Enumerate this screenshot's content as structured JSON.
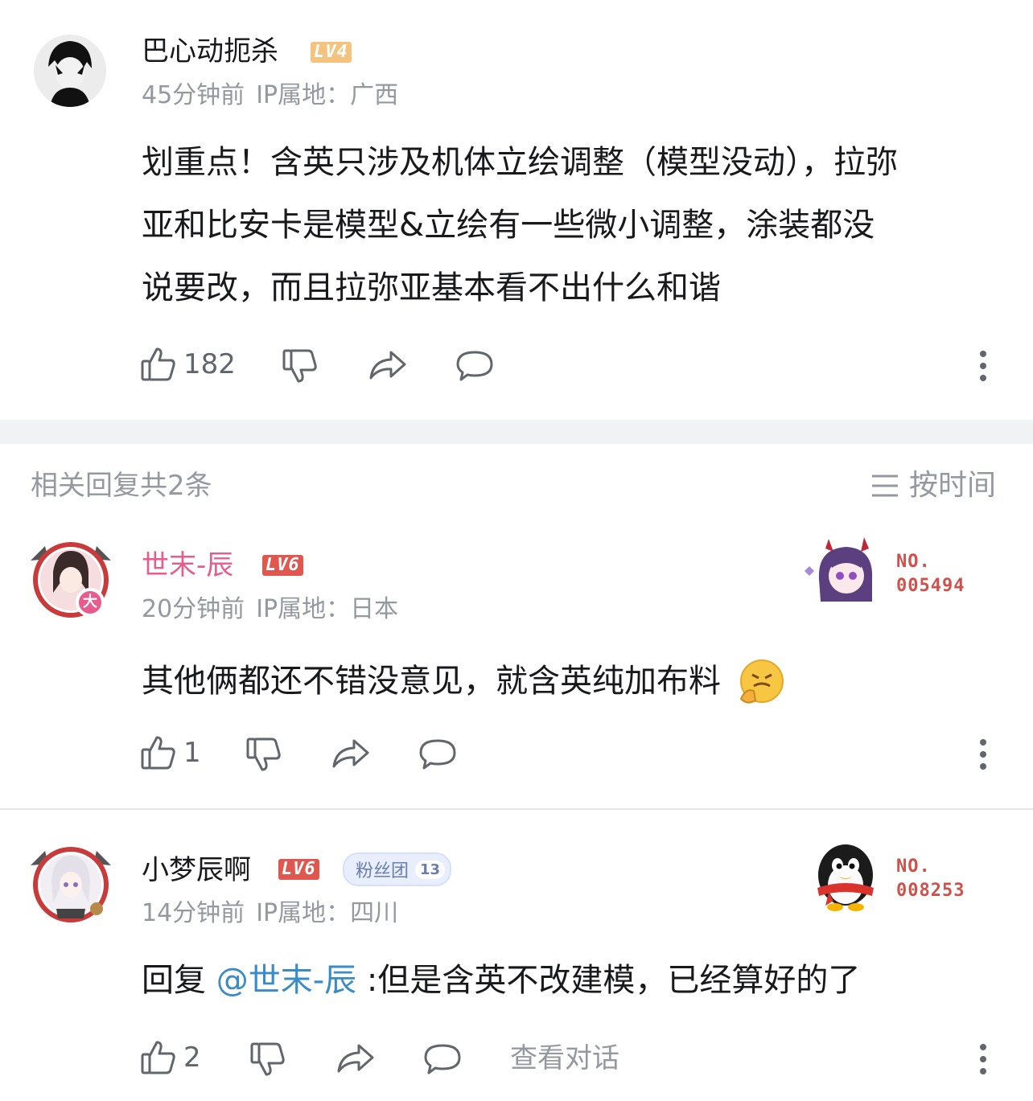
{
  "comment": {
    "user_name": "巴心动扼杀",
    "level": "LV4",
    "time": "45分钟前",
    "ip": "IP属地：广西",
    "text_lines": [
      "划重点！含英只涉及机体立绘调整（模型没动），拉弥",
      "亚和比安卡是模型&立绘有一些微小调整，涂装都没",
      "说要改，而且拉弥亚基本看不出什么和谐"
    ],
    "likes": "182"
  },
  "replies_header": {
    "count_text": "相关回复共2条",
    "sort_label": "按时间"
  },
  "replies": [
    {
      "user_name": "世末-辰",
      "level": "LV6",
      "avatar_badge": "大",
      "time": "20分钟前",
      "ip": "IP属地：日本",
      "no_label": "NO.",
      "no_number": "005494",
      "text": "其他俩都还不错没意见，就含英纯加布料",
      "likes": "1"
    },
    {
      "user_name": "小梦辰啊",
      "level": "LV6",
      "fans_badge": "粉丝团",
      "fans_level": "13",
      "time": "14分钟前",
      "ip": "IP属地：四川",
      "no_label": "NO.",
      "no_number": "008253",
      "reply_prefix": "回复 ",
      "mention": "@世末-辰",
      "text": " :但是含英不改建模，已经算好的了",
      "likes": "2",
      "view_dialog": "查看对话"
    }
  ],
  "colors": {
    "lv4": "#f5c37e",
    "lv6": "#e0574f",
    "pink_name": "#e85c8d",
    "mention": "#3a8cc8",
    "meta": "#9499a0"
  }
}
